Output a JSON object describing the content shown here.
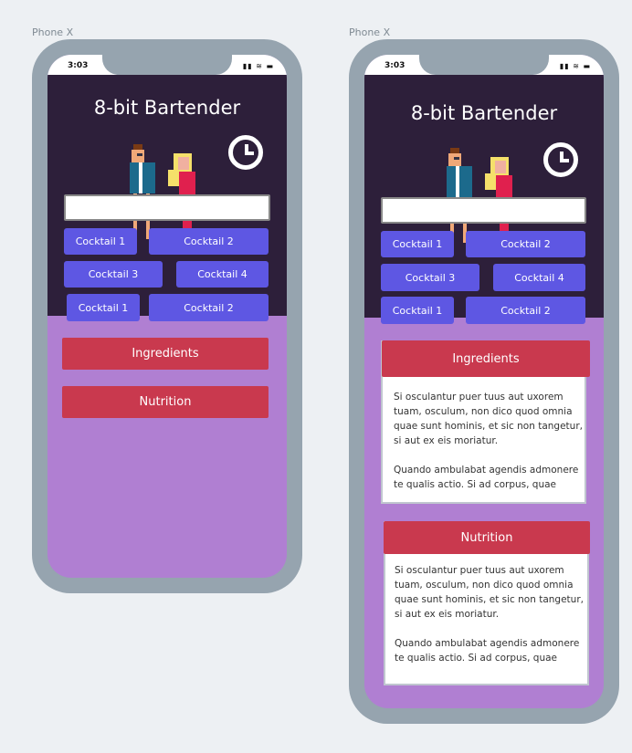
{
  "device_label": "Phone X",
  "status": {
    "time": "3:03"
  },
  "app": {
    "title": "8-bit Bartender",
    "search_value": ""
  },
  "cocktails": [
    "Cocktail 1",
    "Cocktail 2",
    "Cocktail 3",
    "Cocktail 4",
    "Cocktail 1",
    "Cocktail 2"
  ],
  "sections": {
    "ingredients": {
      "label": "Ingredients",
      "p1": "Si osculantur puer tuus aut uxorem tuam, osculum, non dico quod omnia quae sunt hominis, et sic non tangetur, si aut ex eis moriatur.",
      "p2": "Quando ambulabat agendis admonere te qualis actio. Si ad corpus, quae"
    },
    "nutrition": {
      "label": "Nutrition",
      "p1": "Si osculantur puer tuus aut uxorem tuam, osculum, non dico quod omnia quae sunt hominis, et sic non tangetur, si aut ex eis moriatur.",
      "p2": "Quando ambulabat agendis admonere te qualis actio. Si ad corpus, quae"
    }
  },
  "colors": {
    "header_bg": "#2d1f3a",
    "body_bg": "#b07fd2",
    "button": "#5e57e3",
    "section": "#c9394e"
  }
}
